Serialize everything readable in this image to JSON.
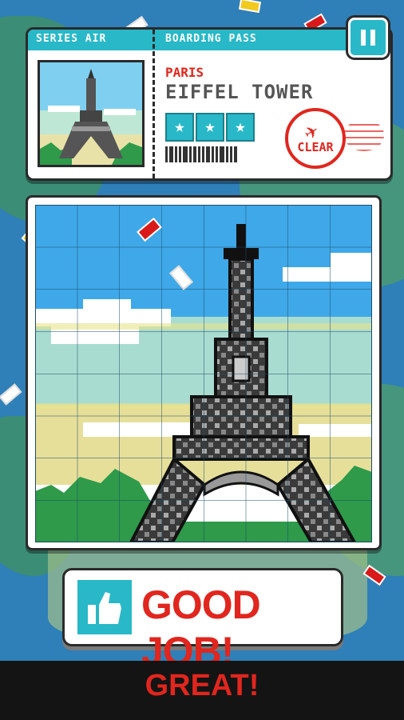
{
  "pass": {
    "airline_label": "SERIES AIR",
    "boarding_label": "BOARDING PASS",
    "city": "PARIS",
    "landmark": "EIFFEL TOWER",
    "stars_earned": 3,
    "stars_total": 3,
    "stamp_text": "CLEAR"
  },
  "pause": {
    "icon": "pause-icon"
  },
  "puzzle": {
    "subject": "eiffel-tower",
    "grid_cols": 8,
    "grid_rows": 8
  },
  "feedback": {
    "button_label": "GOOD JOB!",
    "icon": "thumbs-up-icon"
  },
  "footer": {
    "message": "GREAT!"
  },
  "colors": {
    "accent": "#28b8c8",
    "red": "#e0261e",
    "sky": "#3fa8e8"
  }
}
